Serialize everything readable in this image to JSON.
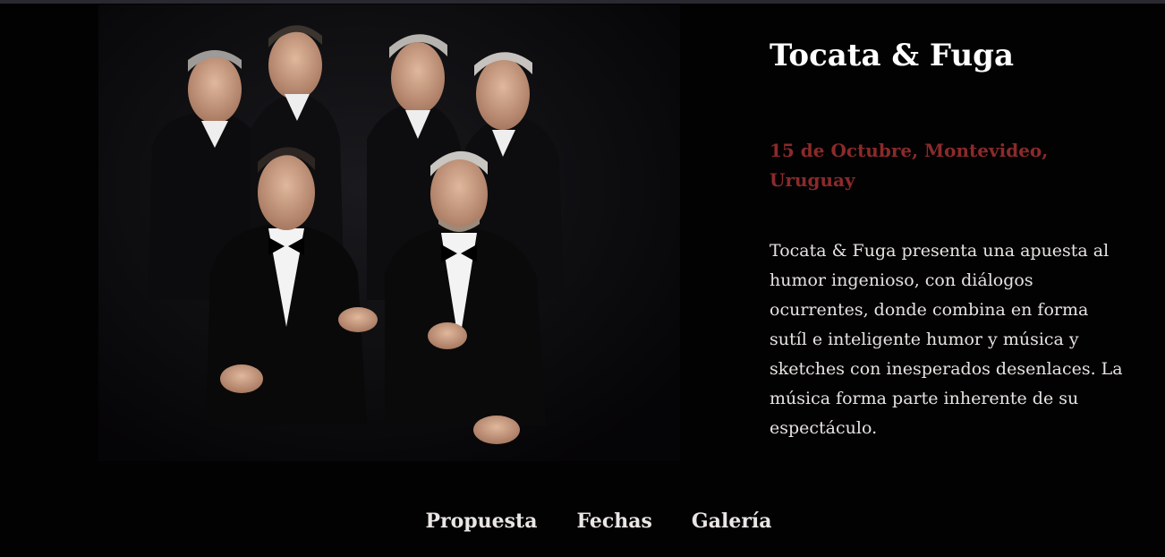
{
  "show": {
    "title": "Tocata & Fuga",
    "date": "15 de Octubre, Montevideo, Uruguay",
    "description": "Tocata & Fuga presenta una apuesta al humor ingenioso, con diálogos ocurrentes, donde combina en forma sutíl e inteligente humor y música y sketches con inesperados desenlaces. La música forma parte inherente de su espectáculo."
  },
  "nav": {
    "items": [
      "Propuesta",
      "Fechas",
      "Galería"
    ]
  },
  "colors": {
    "background": "#030203",
    "title": "#ffffff",
    "date_accent": "#8b2a2a",
    "body_text": "#e6e3e0"
  }
}
